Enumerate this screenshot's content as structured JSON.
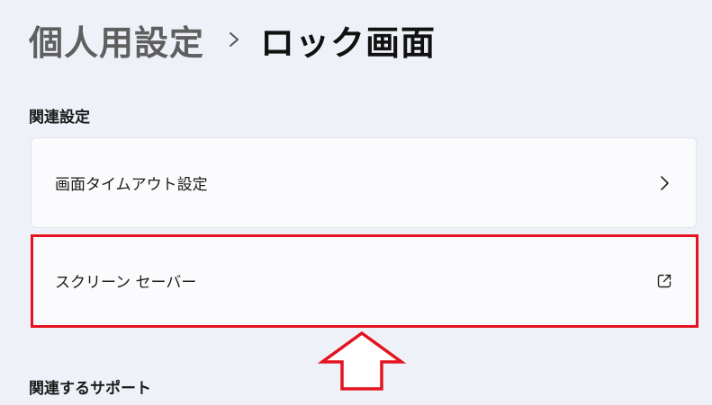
{
  "breadcrumb": {
    "parent": "個人用設定",
    "separator_icon": "chevron-right-icon",
    "current": "ロック画面"
  },
  "related_settings": {
    "title": "関連設定",
    "items": [
      {
        "label": "画面タイムアウト設定",
        "icon": "chevron-right-icon"
      },
      {
        "label": "スクリーン セーバー",
        "icon": "external-link-icon"
      }
    ]
  },
  "related_support": {
    "title": "関連するサポート"
  },
  "annotation": {
    "highlight_color": "#e3141f",
    "arrow_icon": "up-arrow-outline-icon"
  }
}
